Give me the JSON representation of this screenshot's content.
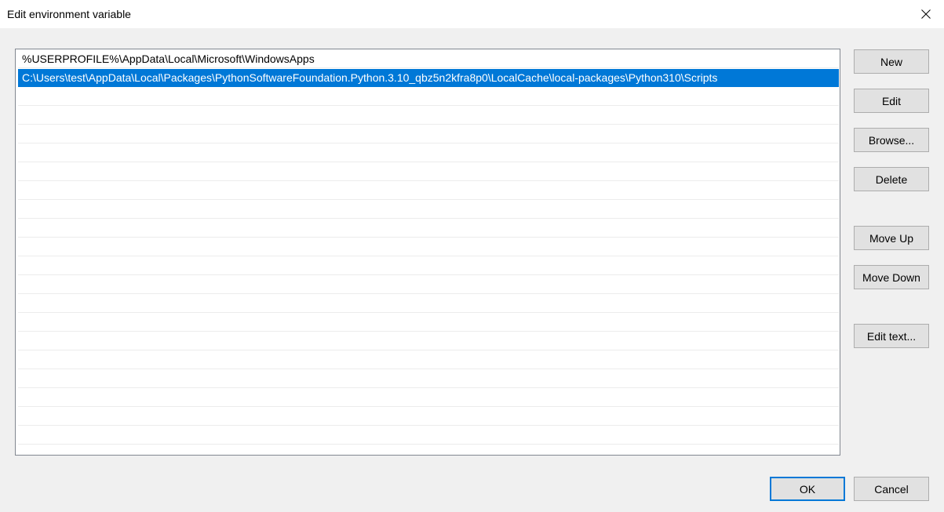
{
  "window": {
    "title": "Edit environment variable",
    "close_icon": "close-icon"
  },
  "list": {
    "items": [
      {
        "text": "%USERPROFILE%\\AppData\\Local\\Microsoft\\WindowsApps",
        "selected": false
      },
      {
        "text": "C:\\Users\\test\\AppData\\Local\\Packages\\PythonSoftwareFoundation.Python.3.10_qbz5n2kfra8p0\\LocalCache\\local-packages\\Python310\\Scripts",
        "selected": true
      }
    ],
    "selection_color": "#0078d7"
  },
  "buttons": {
    "new": "New",
    "edit": "Edit",
    "browse": "Browse...",
    "delete": "Delete",
    "move_up": "Move Up",
    "move_down": "Move Down",
    "edit_text": "Edit text..."
  },
  "footer": {
    "ok": "OK",
    "cancel": "Cancel"
  }
}
